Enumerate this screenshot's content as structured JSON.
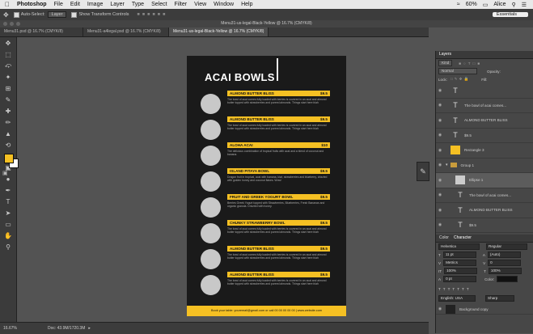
{
  "menubar": {
    "app": "Photoshop",
    "items": [
      "File",
      "Edit",
      "Image",
      "Layer",
      "Type",
      "Select",
      "Filter",
      "View",
      "Window",
      "Help"
    ],
    "battery": "60%",
    "user": "Alice"
  },
  "options": {
    "auto_select_label": "Auto-Select:",
    "auto_select_value": "Layer",
    "transform_label": "Show Transform Controls",
    "workspace": "Essentials"
  },
  "window_title": "Menu31-us-legal-Black-Yellow @ 16.7% (CMYK/8)",
  "tabs": [
    "Menu31.psd @ 16.7% (CMYK/8)",
    "Menu31-a4legal.psd @ 16.7% (CMYK/8)",
    "Menu31-us-legal-Black-Yellow @ 16.7% (CMYK/8)"
  ],
  "document": {
    "title": "ACAI BOWLS",
    "items": [
      {
        "name": "ALMOND BUTTER BLISS",
        "price": "$9.5",
        "desc": "The bowl of acai comes fully loaded with berries is covered in an acai and almond butter topped with strawberries and pureed almonds. Things start here blah"
      },
      {
        "name": "ALMOND BUTTER BLISS",
        "price": "$9.5",
        "desc": "The bowl of acai comes fully loaded with berries is covered in an acai and almond butter topped with strawberries and pureed almonds. Things start here blah"
      },
      {
        "name": "ALOHA ACAI",
        "price": "$10",
        "desc": "The delicious combination of tropical fruits with acai and a blend of coconut and banana."
      },
      {
        "name": "ISLAND PITAYA BOWL",
        "price": "$9.5",
        "desc": "Dragon fruit in tropical, acai with banana, kiwi, strawberries and blueberry, drizzled with golden honey and coconut flakes. Wow!"
      },
      {
        "name": "FRUIT AND GREEK YOGURT BOWL",
        "price": "$9.5",
        "desc": "Berries Greek Yogurt topped with Strawberries, Blueberries, Fresh Bananas and organic granola. Drizzled with honey."
      },
      {
        "name": "CHUNKY STRAWBERRY BOWL",
        "price": "$9.5",
        "desc": "The bowl of acai comes fully loaded with berries is covered in an acai and almond butter topped with strawberries and pureed almonds. Things start here blah"
      },
      {
        "name": "ALMOND BUTTER BLISS",
        "price": "$9.5",
        "desc": "The bowl of acai comes fully loaded with berries is covered in an acai and almond butter topped with strawberries and pureed almonds. Things start here blah"
      },
      {
        "name": "ALMOND BUTTER BLISS",
        "price": "$9.5",
        "desc": "The bowl of acai comes fully loaded with berries is covered in an acai and almond butter topped with strawberries and pureed almonds. Things start here blah"
      }
    ],
    "footer": "Book your table: youremail@gmail.com or call 00 00 00 00 00 | www.website.com"
  },
  "status": {
    "zoom": "16.67%",
    "doc_size": "Doc: 43.9M/1720.3M"
  },
  "layers_panel": {
    "tabs": [
      "Layers"
    ],
    "filter": "Kind",
    "blend_mode": "Normal",
    "opacity_label": "Opacity:",
    "fill_label": "Fill:",
    "lock_label": "Lock:",
    "layers": [
      {
        "name": "",
        "type": "text"
      },
      {
        "name": "The bowl of acai comes...",
        "type": "text"
      },
      {
        "name": "ALMOND BUTTER BLISS",
        "type": "text"
      },
      {
        "name": "$9.5",
        "type": "text"
      },
      {
        "name": "Rectangle 3",
        "type": "shape"
      },
      {
        "name": "Group 1",
        "type": "group"
      },
      {
        "name": "Ellipse 1",
        "type": "shape"
      },
      {
        "name": "The bowl of acai comes...",
        "type": "text"
      },
      {
        "name": "ALMOND BUTTER BLISS",
        "type": "text"
      },
      {
        "name": "$9.5",
        "type": "text"
      }
    ]
  },
  "character_panel": {
    "tabs": [
      "Color",
      "Character"
    ],
    "font_family": "Helvetica",
    "font_style": "Regular",
    "font_size": "11 pt",
    "leading": "(Auto)",
    "kerning": "Metrics",
    "tracking": "0",
    "vscale": "100%",
    "hscale": "100%",
    "baseline": "0 pt",
    "color_label": "Color:",
    "language": "English: USA",
    "antialias": "Sharp"
  },
  "bottom_layer": "Background copy"
}
